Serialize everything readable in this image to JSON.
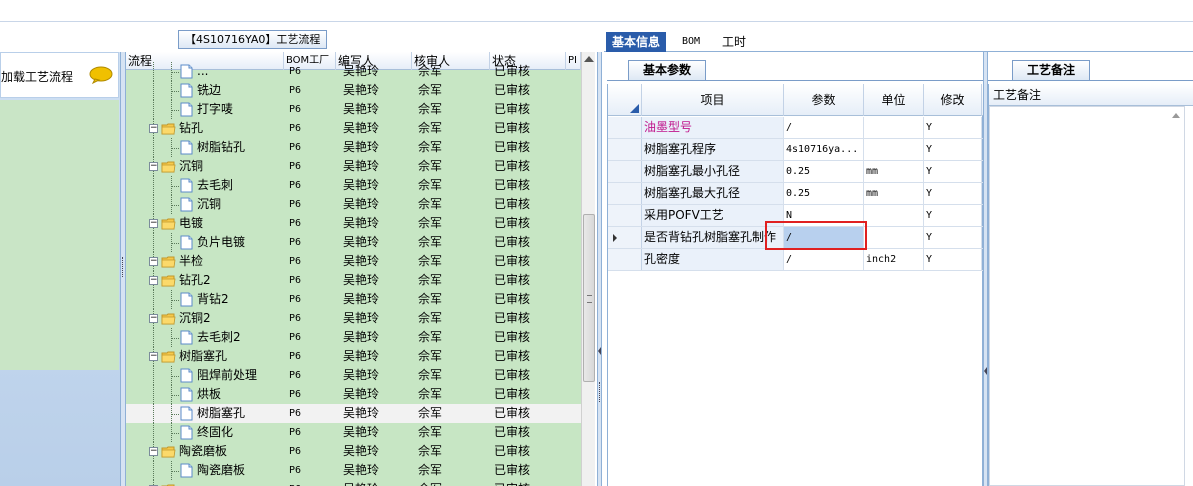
{
  "left_panel": {
    "item_label": "加载工艺流程"
  },
  "tree": {
    "title": "【4S10716YA0】工艺流程",
    "columns": [
      "流程",
      "BOM工厂",
      "编写人",
      "核审人",
      "状态",
      "PI"
    ],
    "rows": [
      {
        "level": 2,
        "type": "doc",
        "name": "...",
        "factory": "P6",
        "writer": "吴艳玲",
        "reviewer": "佘军",
        "status": "已审核"
      },
      {
        "level": 2,
        "type": "doc",
        "name": "铣边",
        "factory": "P6",
        "writer": "吴艳玲",
        "reviewer": "佘军",
        "status": "已审核"
      },
      {
        "level": 2,
        "type": "doc",
        "name": "打字唛",
        "factory": "P6",
        "writer": "吴艳玲",
        "reviewer": "佘军",
        "status": "已审核"
      },
      {
        "level": 1,
        "type": "folder",
        "name": "钻孔",
        "factory": "P6",
        "writer": "吴艳玲",
        "reviewer": "佘军",
        "status": "已审核"
      },
      {
        "level": 2,
        "type": "doc",
        "name": "树脂钻孔",
        "factory": "P6",
        "writer": "吴艳玲",
        "reviewer": "佘军",
        "status": "已审核"
      },
      {
        "level": 1,
        "type": "folder",
        "name": "沉铜",
        "factory": "P6",
        "writer": "吴艳玲",
        "reviewer": "佘军",
        "status": "已审核"
      },
      {
        "level": 2,
        "type": "doc",
        "name": "去毛刺",
        "factory": "P6",
        "writer": "吴艳玲",
        "reviewer": "佘军",
        "status": "已审核"
      },
      {
        "level": 2,
        "type": "doc",
        "name": "沉铜",
        "factory": "P6",
        "writer": "吴艳玲",
        "reviewer": "佘军",
        "status": "已审核"
      },
      {
        "level": 1,
        "type": "folder",
        "name": "电镀",
        "factory": "P6",
        "writer": "吴艳玲",
        "reviewer": "佘军",
        "status": "已审核"
      },
      {
        "level": 2,
        "type": "doc",
        "name": "负片电镀",
        "factory": "P6",
        "writer": "吴艳玲",
        "reviewer": "佘军",
        "status": "已审核"
      },
      {
        "level": 1,
        "type": "folder",
        "name": "半检",
        "factory": "P6",
        "writer": "吴艳玲",
        "reviewer": "佘军",
        "status": "已审核"
      },
      {
        "level": 1,
        "type": "folder",
        "name": "钻孔2",
        "factory": "P6",
        "writer": "吴艳玲",
        "reviewer": "佘军",
        "status": "已审核"
      },
      {
        "level": 2,
        "type": "doc",
        "name": "背钻2",
        "factory": "P6",
        "writer": "吴艳玲",
        "reviewer": "佘军",
        "status": "已审核"
      },
      {
        "level": 1,
        "type": "folder",
        "name": "沉铜2",
        "factory": "P6",
        "writer": "吴艳玲",
        "reviewer": "佘军",
        "status": "已审核"
      },
      {
        "level": 2,
        "type": "doc",
        "name": "去毛刺2",
        "factory": "P6",
        "writer": "吴艳玲",
        "reviewer": "佘军",
        "status": "已审核"
      },
      {
        "level": 1,
        "type": "folder",
        "name": "树脂塞孔",
        "factory": "P6",
        "writer": "吴艳玲",
        "reviewer": "佘军",
        "status": "已审核"
      },
      {
        "level": 2,
        "type": "doc",
        "name": "阻焊前处理",
        "factory": "P6",
        "writer": "吴艳玲",
        "reviewer": "佘军",
        "status": "已审核"
      },
      {
        "level": 2,
        "type": "doc",
        "name": "烘板",
        "factory": "P6",
        "writer": "吴艳玲",
        "reviewer": "佘军",
        "status": "已审核"
      },
      {
        "level": 2,
        "type": "doc",
        "name": "树脂塞孔",
        "factory": "P6",
        "writer": "吴艳玲",
        "reviewer": "佘军",
        "status": "已审核",
        "selected": true
      },
      {
        "level": 2,
        "type": "doc",
        "name": "终固化",
        "factory": "P6",
        "writer": "吴艳玲",
        "reviewer": "佘军",
        "status": "已审核"
      },
      {
        "level": 1,
        "type": "folder",
        "name": "陶瓷磨板",
        "factory": "P6",
        "writer": "吴艳玲",
        "reviewer": "佘军",
        "status": "已审核"
      },
      {
        "level": 2,
        "type": "doc",
        "name": "陶瓷磨板",
        "factory": "P6",
        "writer": "吴艳玲",
        "reviewer": "佘军",
        "status": "已审核"
      },
      {
        "level": 1,
        "type": "folder",
        "name": "...",
        "factory": "P6",
        "writer": "吴艳玲",
        "reviewer": "佘军",
        "status": "已审核"
      }
    ]
  },
  "tabs": [
    {
      "label": "基本信息",
      "active": true
    },
    {
      "label": "BOM",
      "active": false
    },
    {
      "label": "工时",
      "active": false
    }
  ],
  "params_panel": {
    "tab_label": "基本参数",
    "columns": [
      "项目",
      "参数",
      "单位",
      "修改"
    ],
    "rows": [
      {
        "item": "油墨型号",
        "param": "/",
        "unit": "",
        "modify": "Y",
        "magenta": true
      },
      {
        "item": "树脂塞孔程序",
        "param": "4s10716ya...",
        "unit": "",
        "modify": "Y"
      },
      {
        "item": "树脂塞孔最小孔径",
        "param": "0.25",
        "unit": "mm",
        "modify": "Y"
      },
      {
        "item": "树脂塞孔最大孔径",
        "param": "0.25",
        "unit": "mm",
        "modify": "Y"
      },
      {
        "item": "采用POFV工艺",
        "param": "N",
        "unit": "",
        "modify": "Y"
      },
      {
        "item": "是否背钻孔树脂塞孔制作",
        "param": "/",
        "unit": "",
        "modify": "Y",
        "current": true
      },
      {
        "item": "孔密度",
        "param": "/",
        "unit": "inch2",
        "modify": "Y"
      }
    ]
  },
  "notes_panel": {
    "tab_label": "工艺备注",
    "column": "工艺备注"
  },
  "colors": {
    "accent": "#2a5caa",
    "tree_bg": "#c7e6c4",
    "highlight_box": "#e02020",
    "magenta_text": "#c0168c"
  }
}
